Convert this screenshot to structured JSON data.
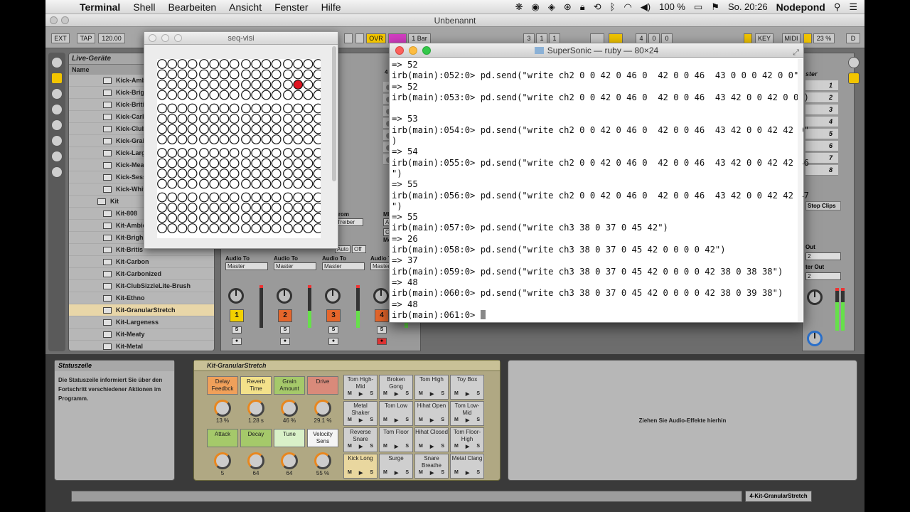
{
  "menubar": {
    "app": "Terminal",
    "items": [
      "Shell",
      "Bearbeiten",
      "Ansicht",
      "Fenster",
      "Hilfe"
    ],
    "battery": "100 %",
    "clock": "So. 20:26",
    "user": "Nodepond"
  },
  "live": {
    "window_title": "Unbenannt",
    "control_bar": {
      "ext": "EXT",
      "tap": "TAP",
      "tempo": "120.00",
      "ovr": "OVR",
      "quant": "1 Bar",
      "pos1": "3",
      "pos2": "1",
      "pos3": "1",
      "loop1": "4",
      "loop2": "0",
      "loop3": "0",
      "key": "KEY",
      "midi": "MIDI",
      "cpu": "23 %",
      "d": "D"
    },
    "browser": {
      "header": "Live-Geräte",
      "column": "Name",
      "items": [
        {
          "label": "Kick-Ambi",
          "type": "item"
        },
        {
          "label": "Kick-Brigh",
          "type": "item"
        },
        {
          "label": "Kick-Britis",
          "type": "item"
        },
        {
          "label": "Kick-Carb",
          "type": "item"
        },
        {
          "label": "Kick-Club",
          "type": "item"
        },
        {
          "label": "Kick-Grain",
          "type": "item"
        },
        {
          "label": "Kick-Larg",
          "type": "item"
        },
        {
          "label": "Kick-Mea",
          "type": "item"
        },
        {
          "label": "Kick-Sess",
          "type": "item"
        },
        {
          "label": "Kick-Whit",
          "type": "item"
        },
        {
          "label": "Kit",
          "type": "folder"
        },
        {
          "label": "Kit-808",
          "type": "item"
        },
        {
          "label": "Kit-Ambie",
          "type": "item"
        },
        {
          "label": "Kit-Brigh",
          "type": "item"
        },
        {
          "label": "Kit-Britis",
          "type": "item"
        },
        {
          "label": "Kit-Carbon",
          "type": "item"
        },
        {
          "label": "Kit-Carbonized",
          "type": "item"
        },
        {
          "label": "Kit-ClubSizzleLite-Brush",
          "type": "item"
        },
        {
          "label": "Kit-Ethno",
          "type": "item"
        },
        {
          "label": "Kit-GranularStretch",
          "type": "item",
          "selected": true
        },
        {
          "label": "Kit-Largeness",
          "type": "item"
        },
        {
          "label": "Kit-Meaty",
          "type": "item"
        },
        {
          "label": "Kit-Metal",
          "type": "item"
        }
      ]
    },
    "mixer": {
      "track_header_808": "808",
      "track_header_kit": "4 Kit",
      "from_label": "From",
      "midi_label": "MIDI I",
      "treiber": "Treiber",
      "all_ins": "All In",
      "ch": "Ch",
      "monitor": "Monit",
      "auto": "Auto",
      "off": "Off",
      "audio_to": "Audio To",
      "master": "Master",
      "tracks": [
        {
          "num": "1",
          "color": "#f2d100"
        },
        {
          "num": "2",
          "color": "#e5662b"
        },
        {
          "num": "3",
          "color": "#e5662b"
        },
        {
          "num": "4",
          "color": "#e5662b"
        }
      ],
      "s_label": "S"
    },
    "master": {
      "header": "ster",
      "slots": [
        "1",
        "2",
        "3",
        "4",
        "5",
        "6",
        "7",
        "8"
      ],
      "stop_clips": "Stop Clips",
      "out1": "Out",
      "out2": "ter Out",
      "out_val": "2"
    },
    "status": {
      "title": "Statuszeile",
      "text": "Die Statuszeile informiert Sie über den Fortschritt verschiedener Aktionen im Programm."
    },
    "device": {
      "name": "Kit-GranularStretch",
      "macros": [
        {
          "name": "Delay Feedbck",
          "value": "13 %",
          "color": "#f0a05a"
        },
        {
          "name": "Reverb Time",
          "value": "1.28 s",
          "color": "#f3e18a"
        },
        {
          "name": "Grain Amount",
          "value": "46 %",
          "color": "#a5c96a"
        },
        {
          "name": "Drive",
          "value": "29.1 %",
          "color": "#d98a7a"
        },
        {
          "name": "Attack",
          "value": "5",
          "color": "#a5c96a"
        },
        {
          "name": "Decay",
          "value": "64",
          "color": "#a5c96a"
        },
        {
          "name": "Tune",
          "value": "64",
          "color": "#d9f0c8"
        },
        {
          "name": "Velocity Sens",
          "value": "55 %",
          "color": "#f4f4f4"
        }
      ],
      "pads": [
        "Tom High-Mid",
        "Broken Gong",
        "Tom High",
        "Toy Box",
        "Metal Shaker",
        "Tom Low",
        "Hihat Open",
        "Tom Low-Mid",
        "Reverse Snare",
        "Tom Floor",
        "Hihat Closed",
        "Tom Floor-High",
        "Kick Long",
        "Surge",
        "Snare Breathe",
        "Metal Clang"
      ],
      "pad_buttons": [
        "M",
        "▶",
        "S"
      ]
    },
    "fx_drop": "Ziehen Sie Audio-Effekte hierhin",
    "bottom_track_name": "4-Kit-GranularStretch"
  },
  "seq_window": {
    "title": "seq-visi",
    "rows": 17,
    "cols": 16,
    "active_red": [
      [
        2,
        13
      ]
    ],
    "active_gray": [
      [
        16,
        13
      ]
    ]
  },
  "terminal": {
    "title": "SuperSonic — ruby — 80×24",
    "lines": [
      "=> 52",
      "irb(main):052:0> pd.send(\"write ch2 0 0 42 0 46 0  42 0 0 46  43 0 0 0 42 0 0\")",
      "=> 52",
      "irb(main):053:0> pd.send(\"write ch2 0 0 42 0 46 0  42 0 0 46  43 42 0 0 42 0 0\")",
      "",
      "=> 53",
      "irb(main):054:0> pd.send(\"write ch2 0 0 42 0 46 0  42 0 0 46  43 42 0 0 42 42 0\"",
      ")",
      "=> 54",
      "irb(main):055:0> pd.send(\"write ch2 0 0 42 0 46 0  42 0 0 46  43 42 0 0 42 42 46",
      "\")",
      "=> 55",
      "irb(main):056:0> pd.send(\"write ch2 0 0 42 0 46 0  42 0 0 46  43 42 0 0 42 42 47",
      "\")",
      "=> 55",
      "irb(main):057:0> pd.send(\"write ch3 38 0 37 0 45 42\")",
      "=> 26",
      "irb(main):058:0> pd.send(\"write ch3 38 0 37 0 45 42 0 0 0 0 42\")",
      "=> 37",
      "irb(main):059:0> pd.send(\"write ch3 38 0 37 0 45 42 0 0 0 0 42 38 0 38 38\")",
      "=> 48",
      "irb(main):060:0> pd.send(\"write ch3 38 0 37 0 45 42 0 0 0 0 42 38 0 39 38\")",
      "=> 48"
    ],
    "prompt": "irb(main):061:0> "
  }
}
